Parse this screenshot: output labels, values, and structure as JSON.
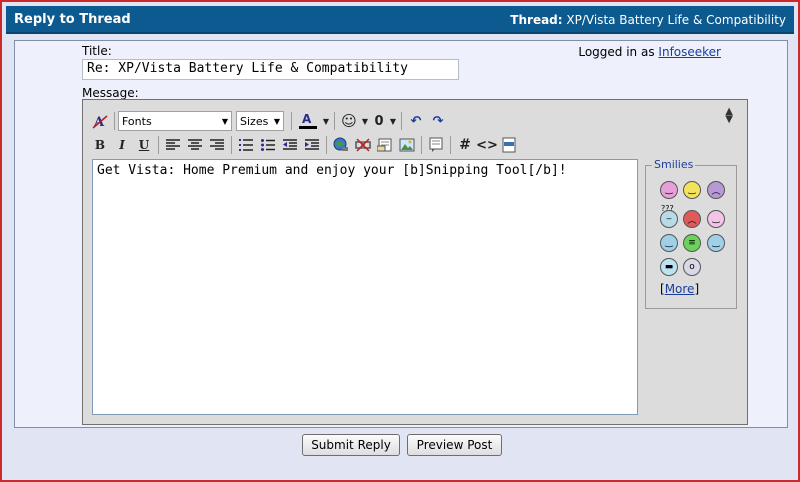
{
  "header": {
    "title": "Reply to Thread",
    "thread_label": "Thread:",
    "thread_name": "XP/Vista Battery Life & Compatibility"
  },
  "form": {
    "title_label": "Title:",
    "title_value": "Re: XP/Vista Battery Life & Compatibility",
    "logged_in_prefix": "Logged in as",
    "username": "Infoseeker",
    "message_label": "Message:"
  },
  "toolbar": {
    "fonts": "Fonts",
    "sizes": "Sizes",
    "bold": "B",
    "italic": "I",
    "underline": "U",
    "code_hash": "#",
    "code_html": "<>"
  },
  "editor": {
    "content": "Get Vista: Home Premium and enjoy your [b]Snipping Tool[/b]!"
  },
  "smilies": {
    "legend": "Smilies",
    "more": "More",
    "confused_text": "???"
  },
  "buttons": {
    "submit": "Submit Reply",
    "preview": "Preview Post"
  },
  "colors": {
    "header_bg": "#0c5a8f",
    "frame_border": "#cc2a2a",
    "link": "#1a3e9c"
  }
}
